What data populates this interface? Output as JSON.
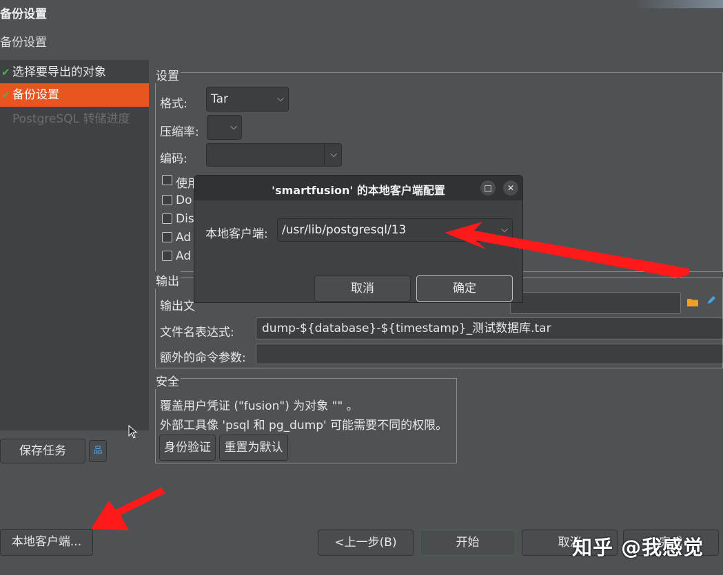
{
  "window": {
    "title": "备份设置",
    "subtitle": "备份设置"
  },
  "sidebar": {
    "items": [
      {
        "label": "选择要导出的对象",
        "check": "✔"
      },
      {
        "label": "备份设置",
        "check": "✔"
      },
      {
        "label": "PostgreSQL 转储进度"
      }
    ],
    "save_task_label": "保存任务",
    "tree_icon": "tree-structure-icon"
  },
  "settings": {
    "title": "设置",
    "format_label": "格式:",
    "format_value": "Tar",
    "compression_label": "压缩率:",
    "compression_value": "",
    "encoding_label": "编码:",
    "encoding_value": "",
    "checkboxes": [
      "使用",
      "Do",
      "Dis",
      "Ad",
      "Ad"
    ]
  },
  "output": {
    "title": "输出",
    "output_file_label": "输出文",
    "output_file_value": "",
    "folder_icon": "folder-icon",
    "edit_icon": "pencil-icon",
    "filename_expr_label": "文件名表达式:",
    "filename_expr_value": "dump-${database}-${timestamp}_测试数据库.tar",
    "extra_args_label": "额外的命令参数:",
    "extra_args_value": ""
  },
  "security": {
    "title": "安全",
    "line1": "覆盖用户凭证 (\"fusion\") 为对象 \"\" 。",
    "line2": "外部工具像 'psql 和 pg_dump' 可能需要不同的权限。",
    "auth_button": "身份验证",
    "reset_button": "重置为默认"
  },
  "dialog": {
    "title": "'smartfusion' 的本地客户端配置",
    "client_label": "本地客户端:",
    "client_value": "/usr/lib/postgresql/13",
    "cancel": "取消",
    "ok": "确定",
    "maximize_icon": "□",
    "close_icon": "✕"
  },
  "footer": {
    "local_client": "本地客户端...",
    "back": "<上一步(B)",
    "start": "开始",
    "cancel": "取消",
    "extra": "完成"
  },
  "watermark": "知乎 @我感觉",
  "colors": {
    "accent": "#e95420",
    "arrow": "#ff1a1a",
    "check": "#4db04d"
  }
}
